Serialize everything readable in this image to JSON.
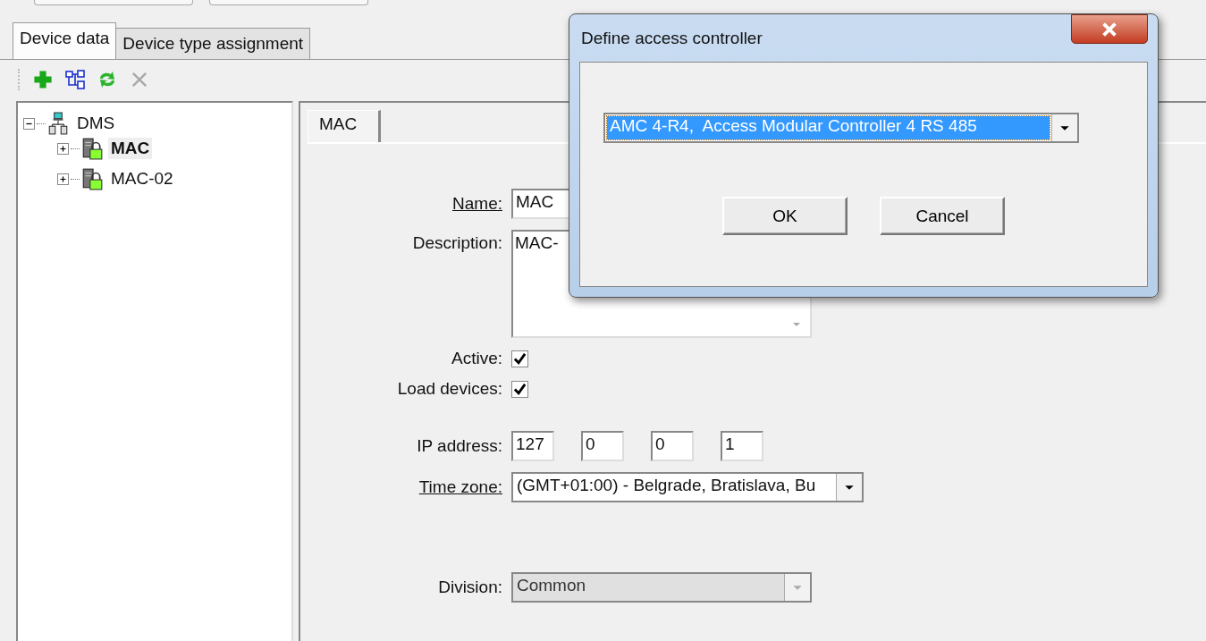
{
  "tabs": [
    {
      "label": "Device data",
      "selected": true
    },
    {
      "label": "Device type assignment",
      "selected": false
    }
  ],
  "toolbar": [
    {
      "kind": "add",
      "disabled": false
    },
    {
      "kind": "tree",
      "disabled": false
    },
    {
      "kind": "refresh",
      "disabled": false
    },
    {
      "kind": "delete",
      "disabled": true
    }
  ],
  "tree": [
    {
      "label": "DMS",
      "kind": "workstation",
      "expanded": true,
      "selected": false,
      "children": [
        {
          "label": "MAC",
          "kind": "controller",
          "expanded": false,
          "selected": true
        },
        {
          "label": "MAC-02",
          "kind": "controller",
          "expanded": false,
          "selected": false
        }
      ]
    }
  ],
  "detail_tab": {
    "label": "MAC"
  },
  "form": {
    "name": {
      "label": "Name:",
      "underlined": true,
      "value": "MAC"
    },
    "description": {
      "label": "Description:",
      "underlined": false,
      "value": "MAC-"
    },
    "active": {
      "label": "Active:",
      "checked": true
    },
    "load_devices": {
      "label": "Load devices:",
      "checked": true
    },
    "ip_address": {
      "label": "IP address:",
      "parts": [
        "127",
        "0",
        "0",
        "1"
      ]
    },
    "time_zone": {
      "label": "Time zone:",
      "underlined": true,
      "value": "(GMT+01:00) - Belgrade, Bratislava, Bu"
    },
    "division": {
      "label": "Division:",
      "value": "Common",
      "disabled": true
    }
  },
  "dialog": {
    "title": "Define access controller",
    "combo": {
      "value": "AMC 4-R4,  Access Modular Controller 4 RS 485",
      "highlighted": true
    },
    "buttons": [
      "OK",
      "Cancel"
    ]
  }
}
